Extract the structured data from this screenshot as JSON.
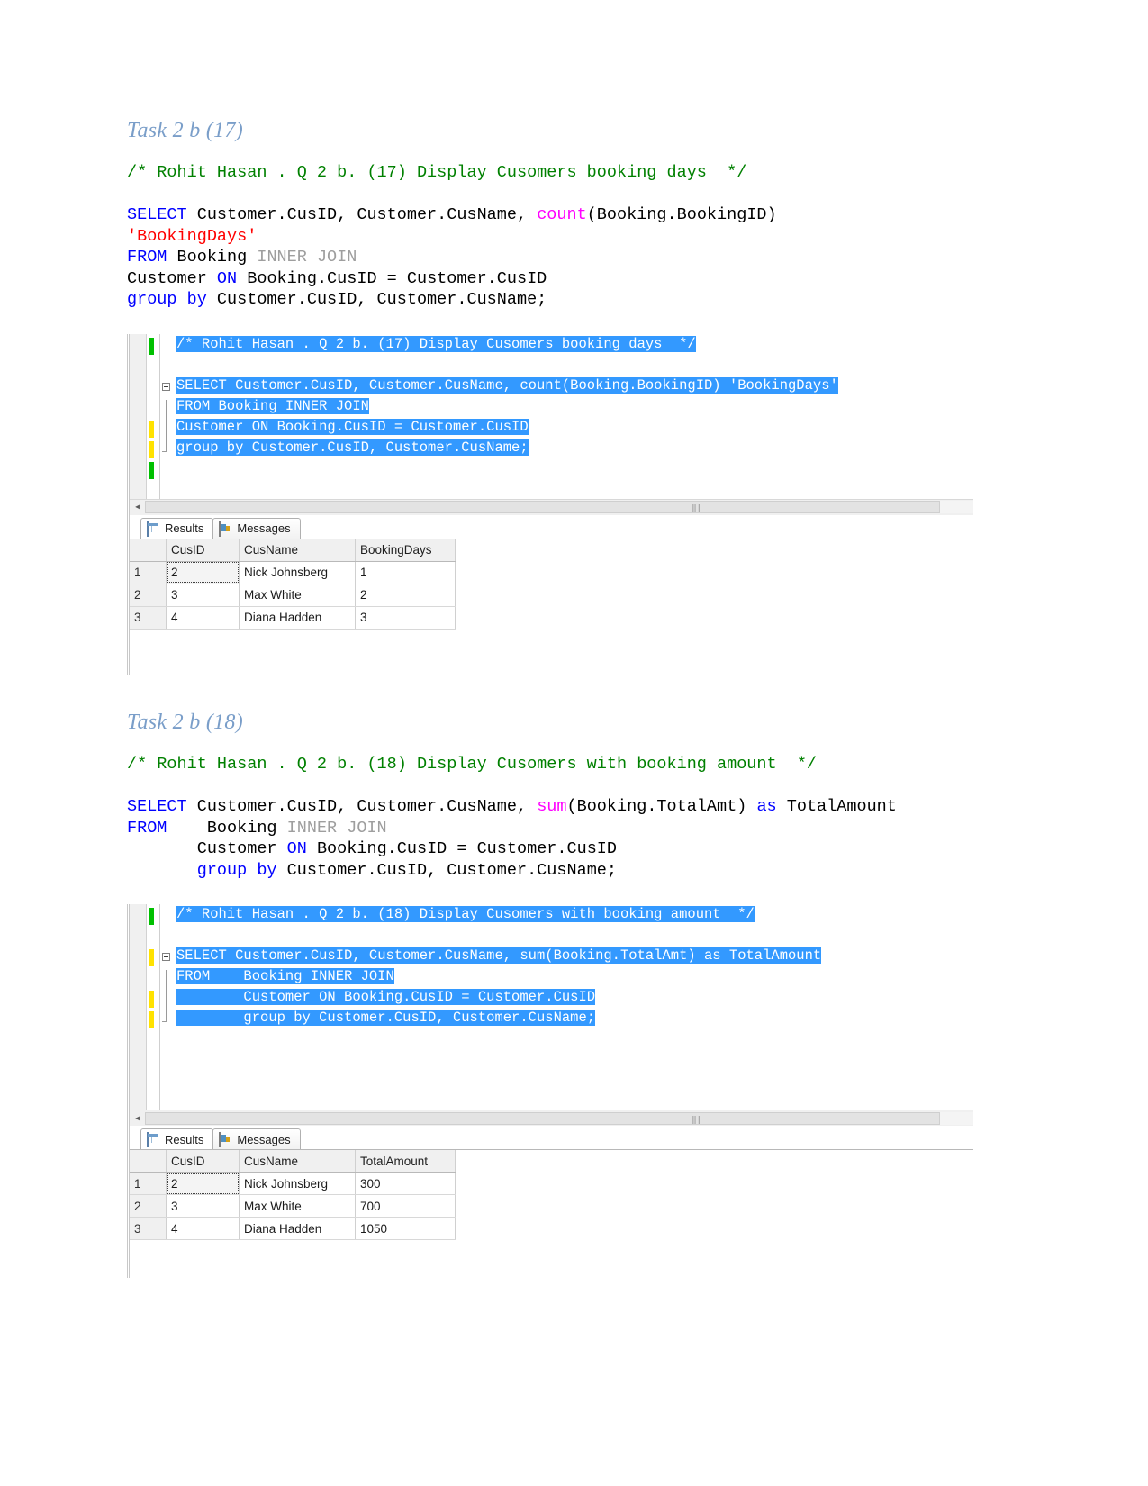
{
  "sections": [
    {
      "heading": "Task 2 b (17)",
      "doc_code": [
        [
          {
            "t": "/* Rohit Hasan . Q 2 b. (17) Display Cusomers booking days  */",
            "c": "kw-green"
          }
        ],
        [],
        [
          {
            "t": "SELECT ",
            "c": "kw-blue"
          },
          {
            "t": "Customer.CusID, Customer.CusName, ",
            "c": "kw-black"
          },
          {
            "t": "count",
            "c": "kw-pink"
          },
          {
            "t": "(Booking.BookingID)",
            "c": "kw-black"
          }
        ],
        [
          {
            "t": "'BookingDays'",
            "c": "kw-red"
          }
        ],
        [
          {
            "t": "FROM ",
            "c": "kw-blue"
          },
          {
            "t": "Booking ",
            "c": "kw-black"
          },
          {
            "t": "INNER JOIN",
            "c": "kw-gray"
          }
        ],
        [
          {
            "t": "Customer ",
            "c": "kw-black"
          },
          {
            "t": "ON ",
            "c": "kw-blue"
          },
          {
            "t": "Booking.CusID = Customer.CusID",
            "c": "kw-black"
          }
        ],
        [
          {
            "t": "group by ",
            "c": "kw-blue"
          },
          {
            "t": "Customer.CusID, Customer.CusName;",
            "c": "kw-black"
          }
        ]
      ],
      "editor_lines": [
        {
          "text": "/* Rohit Hasan . Q 2 b. (17) Display Cusomers booking days  */",
          "selected": true,
          "mark": "green",
          "fold": "none"
        },
        {
          "text": "",
          "selected": false,
          "mark": "none",
          "fold": "none"
        },
        {
          "text": "SELECT Customer.CusID, Customer.CusName, count(Booking.BookingID) 'BookingDays'",
          "selected": true,
          "mark": "none",
          "fold": "start"
        },
        {
          "text": "FROM Booking INNER JOIN",
          "selected": true,
          "mark": "none",
          "fold": "bar"
        },
        {
          "text": "Customer ON Booking.CusID = Customer.CusID",
          "selected": true,
          "mark": "yellow",
          "fold": "bar"
        },
        {
          "text": "group by Customer.CusID, Customer.CusName;",
          "selected": true,
          "mark": "yellow",
          "fold": "end"
        },
        {
          "text": "",
          "selected": false,
          "mark": "green",
          "fold": "none"
        }
      ],
      "tabs": [
        {
          "label": "Results",
          "icon": "grid-icon",
          "active": true
        },
        {
          "label": "Messages",
          "icon": "message-icon",
          "active": false
        }
      ],
      "grid": {
        "columns": [
          "",
          "CusID",
          "CusName",
          "BookingDays"
        ],
        "rows": [
          {
            "num": "1",
            "cells": [
              "2",
              "Nick Johnsberg",
              "1"
            ]
          },
          {
            "num": "2",
            "cells": [
              "3",
              "Max White",
              "2"
            ]
          },
          {
            "num": "3",
            "cells": [
              "4",
              "Diana Hadden",
              "3"
            ]
          }
        ]
      }
    },
    {
      "heading": "Task 2 b (18)",
      "doc_code": [
        [
          {
            "t": "/* Rohit Hasan . Q 2 b. (18) Display Cusomers with booking amount  */",
            "c": "kw-green"
          }
        ],
        [],
        [
          {
            "t": "SELECT ",
            "c": "kw-blue"
          },
          {
            "t": "Customer.CusID, Customer.CusName, ",
            "c": "kw-black"
          },
          {
            "t": "sum",
            "c": "kw-pink"
          },
          {
            "t": "(Booking.TotalAmt) ",
            "c": "kw-black"
          },
          {
            "t": "as ",
            "c": "kw-blue"
          },
          {
            "t": "TotalAmount",
            "c": "kw-black"
          }
        ],
        [
          {
            "t": "FROM ",
            "c": "kw-blue"
          },
          {
            "t": "   Booking ",
            "c": "kw-black"
          },
          {
            "t": "INNER JOIN",
            "c": "kw-gray"
          }
        ],
        [
          {
            "t": "       Customer ",
            "c": "kw-black"
          },
          {
            "t": "ON ",
            "c": "kw-blue"
          },
          {
            "t": "Booking.CusID = Customer.CusID",
            "c": "kw-black"
          }
        ],
        [
          {
            "t": "       group by ",
            "c": "kw-blue"
          },
          {
            "t": "Customer.CusID, Customer.CusName;",
            "c": "kw-black"
          }
        ]
      ],
      "editor_lines": [
        {
          "text": "/* Rohit Hasan . Q 2 b. (18) Display Cusomers with booking amount  */",
          "selected": true,
          "mark": "green",
          "fold": "none"
        },
        {
          "text": "",
          "selected": false,
          "mark": "none",
          "fold": "none"
        },
        {
          "text": "SELECT Customer.CusID, Customer.CusName, sum(Booking.TotalAmt) as TotalAmount",
          "selected": true,
          "mark": "yellow",
          "fold": "start"
        },
        {
          "text": "FROM    Booking INNER JOIN",
          "selected": true,
          "mark": "none",
          "fold": "bar"
        },
        {
          "text": "        Customer ON Booking.CusID = Customer.CusID",
          "selected": true,
          "mark": "yellow",
          "fold": "bar"
        },
        {
          "text": "        group by Customer.CusID, Customer.CusName;",
          "selected": true,
          "mark": "yellow",
          "fold": "end"
        }
      ],
      "tabs": [
        {
          "label": "Results",
          "icon": "grid-icon",
          "active": true
        },
        {
          "label": "Messages",
          "icon": "message-icon",
          "active": false
        }
      ],
      "grid": {
        "columns": [
          "",
          "CusID",
          "CusName",
          "TotalAmount"
        ],
        "rows": [
          {
            "num": "1",
            "cells": [
              "2",
              "Nick Johnsberg",
              "300"
            ]
          },
          {
            "num": "2",
            "cells": [
              "3",
              "Max White",
              "700"
            ]
          },
          {
            "num": "3",
            "cells": [
              "4",
              "Diana Hadden",
              "1050"
            ]
          }
        ]
      }
    }
  ],
  "colors": {
    "heading": "#7a9ec9",
    "comment": "#008000",
    "keyword": "#0000ff",
    "function": "#ff00ff",
    "string": "#ff0000",
    "dim": "#9e9e9e",
    "selection": "#3399ff"
  }
}
